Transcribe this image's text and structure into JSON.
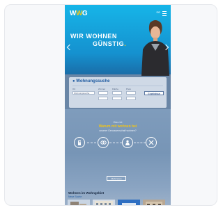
{
  "brand": {
    "logo_prefix": "W",
    "logo_accent": "W",
    "logo_suffix": "G"
  },
  "header": {
    "language": "DE"
  },
  "hero": {
    "line1": "WIR WOHNEN",
    "line2": "GÜNSTIG",
    "line2_dot": "."
  },
  "search": {
    "title": "Wohnungssuche",
    "fields": [
      {
        "label": "Ort",
        "value": "Wohnungssuche"
      },
      {
        "label": "Zimmer",
        "value": ""
      },
      {
        "label": "Fläche",
        "value": ""
      },
      {
        "label": "Preis",
        "value": ""
      }
    ],
    "button_label": "Ergebnisse"
  },
  "why": {
    "kicker": "Was ist",
    "title": "Warum mit wohnen bei",
    "subtitle": "unserer Genossenschaft wohnen?"
  },
  "features": [
    {
      "icon": "building-icon",
      "text": ""
    },
    {
      "icon": "link-icon",
      "text": ""
    },
    {
      "icon": "person-icon",
      "text": ""
    },
    {
      "icon": "tools-icon",
      "text": ""
    }
  ],
  "more_button": "Mehr lesen",
  "offers": {
    "title": "Wohnen im Wohngebiet",
    "link": "Neue Suche"
  },
  "colors": {
    "hero_blue": "#16b5e8",
    "accent_yellow": "#f0c419",
    "link_blue": "#1e5aa0"
  }
}
